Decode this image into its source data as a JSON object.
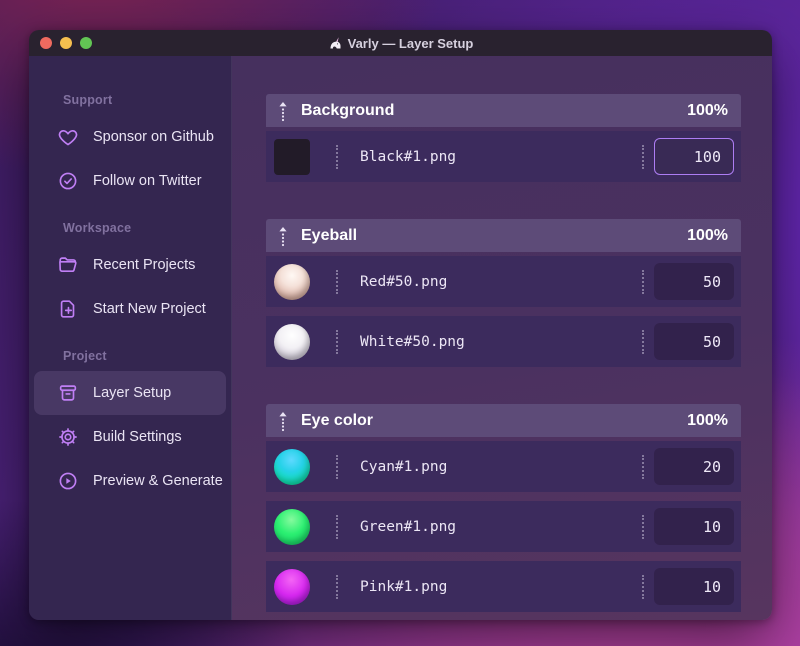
{
  "window": {
    "title": "Varly — Layer Setup",
    "app_icon": "unicorn-icon",
    "traffic_lights": {
      "close": "#ee6a5f",
      "minimize": "#f5bf4f",
      "zoom": "#62c554"
    }
  },
  "sidebar": {
    "sections": [
      {
        "heading": "Support",
        "items": [
          {
            "icon": "heart-icon",
            "label": "Sponsor on Github",
            "active": false
          },
          {
            "icon": "badge-check-icon",
            "label": "Follow on Twitter",
            "active": false
          }
        ]
      },
      {
        "heading": "Workspace",
        "items": [
          {
            "icon": "folder-icon",
            "label": "Recent Projects",
            "active": false
          },
          {
            "icon": "document-plus-icon",
            "label": "Start New Project",
            "active": false
          }
        ]
      },
      {
        "heading": "Project",
        "items": [
          {
            "icon": "archive-box-icon",
            "label": "Layer Setup",
            "active": true
          },
          {
            "icon": "gear-icon",
            "label": "Build Settings",
            "active": false
          },
          {
            "icon": "play-circle-icon",
            "label": "Preview & Generate",
            "active": false
          }
        ]
      }
    ]
  },
  "layers": {
    "groups": [
      {
        "name": "Background",
        "weight": "100%",
        "items": [
          {
            "thumb": "black-square",
            "file": "Black#1.png",
            "value": "100",
            "focused": true
          }
        ]
      },
      {
        "name": "Eyeball",
        "weight": "100%",
        "items": [
          {
            "thumb": "red-sphere",
            "file": "Red#50.png",
            "value": "50",
            "focused": false
          },
          {
            "thumb": "white-sphere",
            "file": "White#50.png",
            "value": "50",
            "focused": false
          }
        ]
      },
      {
        "name": "Eye color",
        "weight": "100%",
        "items": [
          {
            "thumb": "cyan-sphere",
            "file": "Cyan#1.png",
            "value": "20",
            "focused": false
          },
          {
            "thumb": "green-sphere",
            "file": "Green#1.png",
            "value": "10",
            "focused": false
          },
          {
            "thumb": "pink-sphere",
            "file": "Pink#1.png",
            "value": "10",
            "focused": false
          }
        ]
      }
    ]
  },
  "colors": {
    "titlebar": "#29222f",
    "sidebar_bg": "#342650",
    "main_bg": "#4b3160",
    "group_header_bg": "#5d4b78",
    "row_bg": "#3c2b5d",
    "accent_icon": "#c07ff5",
    "focused_input_border": "#ad7df3"
  }
}
